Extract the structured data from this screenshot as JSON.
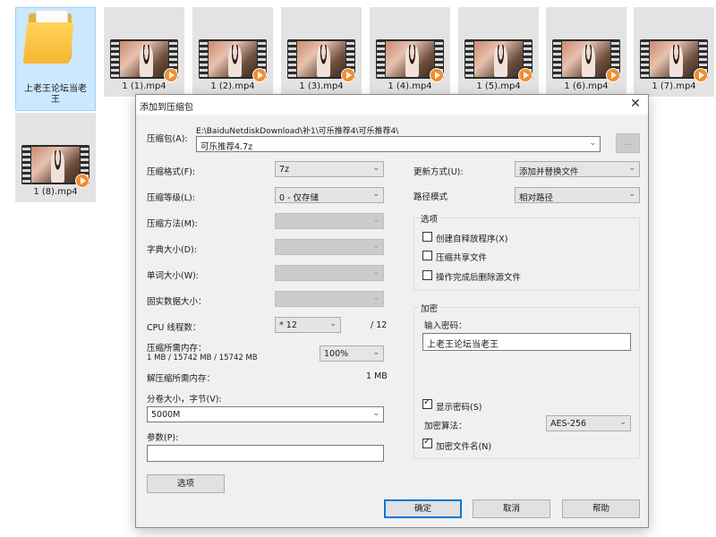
{
  "files": [
    {
      "name": "上老王论坛当老\n王",
      "type": "folder"
    },
    {
      "name": "1 (1).mp4",
      "type": "video"
    },
    {
      "name": "1 (2).mp4",
      "type": "video"
    },
    {
      "name": "1 (3).mp4",
      "type": "video"
    },
    {
      "name": "1 (4).mp4",
      "type": "video"
    },
    {
      "name": "1 (5).mp4",
      "type": "video"
    },
    {
      "name": "1 (6).mp4",
      "type": "video"
    },
    {
      "name": "1 (7).mp4",
      "type": "video"
    },
    {
      "name": "1 (8).mp4",
      "type": "video"
    }
  ],
  "dialog": {
    "title": "添加到压缩包",
    "close_icon": "close-icon",
    "archive_label": "压缩包(A):",
    "archive_path": "E:\\BaiduNetdiskDownload\\补1\\可乐推荐4\\可乐推荐4\\",
    "archive_name": "可乐推荐4.7z",
    "browse_label": "...",
    "format_label": "压缩格式(F):",
    "format_value": "7z",
    "level_label": "压缩等级(L):",
    "level_value": "0 - 仅存储",
    "method_label": "压缩方法(M):",
    "dict_label": "字典大小(D):",
    "word_label": "单词大小(W):",
    "solid_label": "固实数据大小：",
    "threads_label": "CPU 线程数：",
    "threads_value": "* 12",
    "threads_max": "/ 12",
    "mem_compress_label": "压缩所需内存：",
    "mem_compress_value": "1 MB / 15742 MB / 15742 MB",
    "mem_percent": "100%",
    "mem_decompress_label": "解压缩所需内存：",
    "mem_decompress_value": "1 MB",
    "volume_label": "分卷大小，字节(V):",
    "volume_value": "5000M",
    "params_label": "参数(P):",
    "params_value": "",
    "options_button": "选项",
    "update_label": "更新方式(U):",
    "update_value": "添加并替换文件",
    "pathmode_label": "路径模式",
    "pathmode_value": "相对路径",
    "options_group": "选项",
    "opt_sfx": "创建自释放程序(X)",
    "opt_shared": "压缩共享文件",
    "opt_delete": "操作完成后删除源文件",
    "encrypt_group": "加密",
    "password_label": "输入密码：",
    "password_value": "上老王论坛当老王",
    "show_password": "显示密码(S)",
    "enc_method_label": "加密算法：",
    "enc_method_value": "AES-256",
    "encrypt_names": "加密文件名(N)",
    "ok": "确定",
    "cancel": "取消",
    "help": "帮助"
  }
}
